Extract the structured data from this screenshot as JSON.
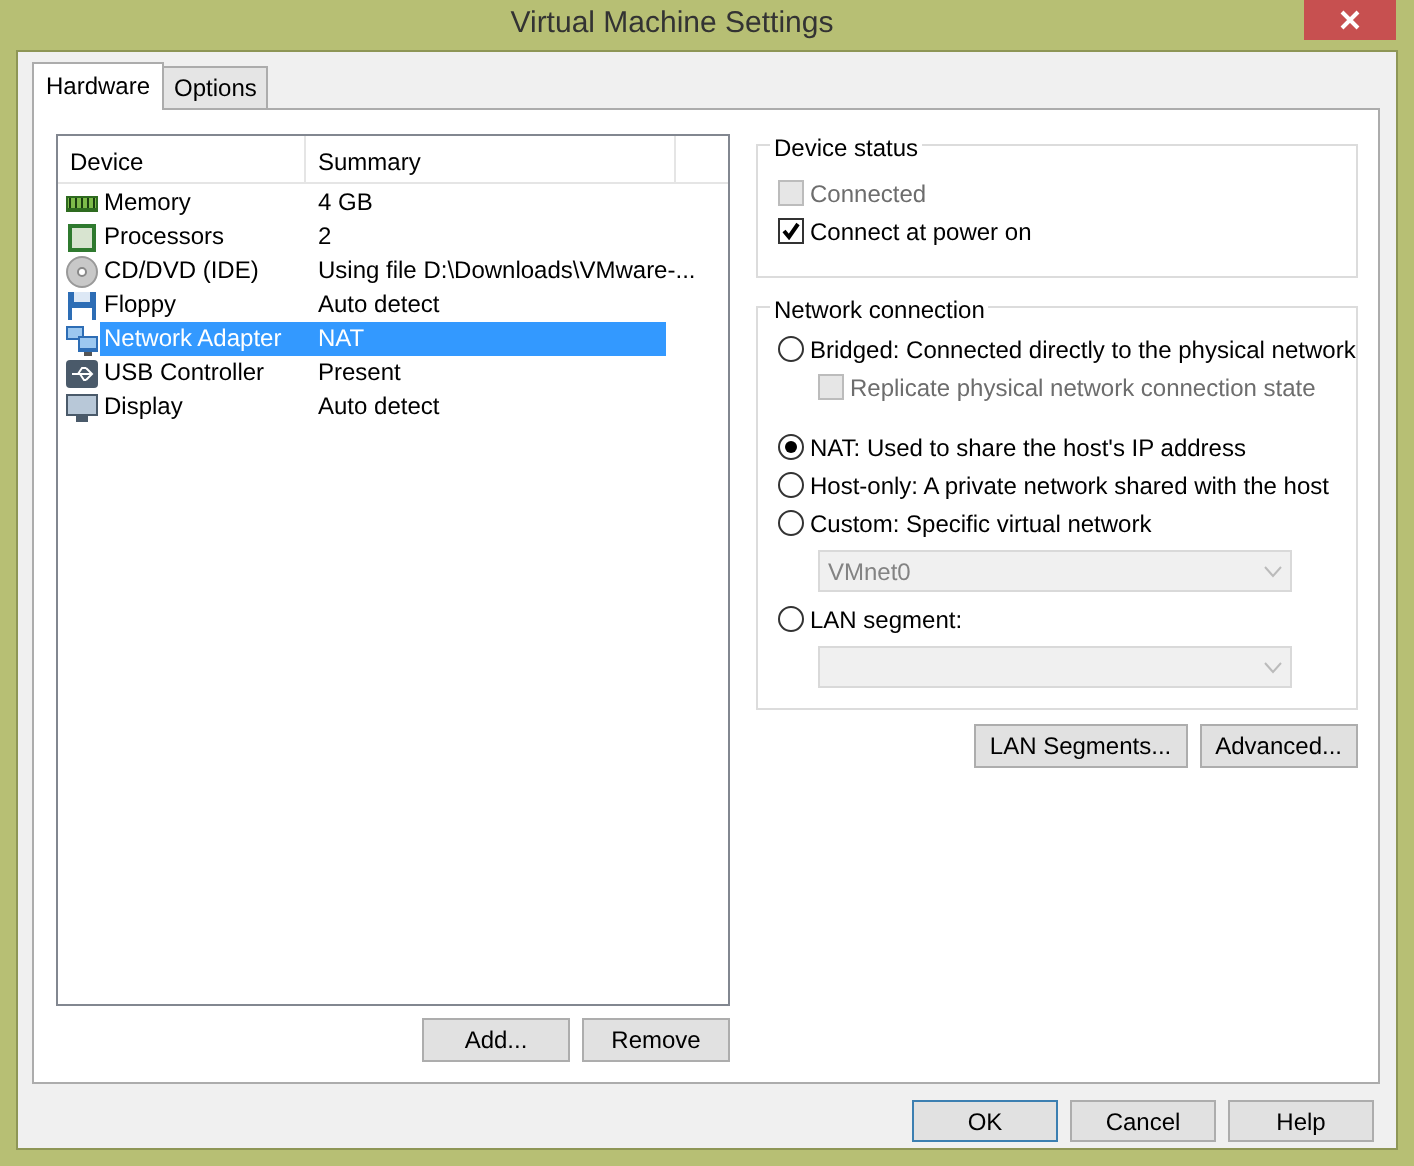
{
  "window": {
    "title": "Virtual Machine Settings"
  },
  "tabs": [
    {
      "label": "Hardware",
      "selected": true
    },
    {
      "label": "Options",
      "selected": false
    }
  ],
  "device_table": {
    "columns": [
      "Device",
      "Summary"
    ],
    "rows": [
      {
        "kind": "memory",
        "device": "Memory",
        "summary": "4 GB",
        "selected": false
      },
      {
        "kind": "processor",
        "device": "Processors",
        "summary": "2",
        "selected": false
      },
      {
        "kind": "disc",
        "device": "CD/DVD (IDE)",
        "summary": "Using file D:\\Downloads\\VMware-...",
        "selected": false
      },
      {
        "kind": "floppy",
        "device": "Floppy",
        "summary": "Auto detect",
        "selected": false
      },
      {
        "kind": "network",
        "device": "Network Adapter",
        "summary": "NAT",
        "selected": true
      },
      {
        "kind": "usb",
        "device": "USB Controller",
        "summary": "Present",
        "selected": false
      },
      {
        "kind": "display",
        "device": "Display",
        "summary": "Auto detect",
        "selected": false
      }
    ]
  },
  "list_buttons": [
    "Add...",
    "Remove"
  ],
  "device_status": {
    "title": "Device status",
    "checkboxes": [
      {
        "label": "Connected",
        "checked": false,
        "disabled": true
      },
      {
        "label": "Connect at power on",
        "checked": true,
        "disabled": false
      }
    ]
  },
  "network_connection": {
    "title": "Network connection",
    "options": [
      {
        "kind": "radio",
        "label": "Bridged: Connected directly to the physical network",
        "selected": false
      },
      {
        "kind": "checkbox",
        "label": "Replicate physical network connection state",
        "checked": false,
        "disabled": true
      },
      {
        "kind": "radio",
        "label": "NAT: Used to share the host's IP address",
        "selected": true
      },
      {
        "kind": "radio",
        "label": "Host-only: A private network shared with the host",
        "selected": false
      },
      {
        "kind": "radio",
        "label": "Custom: Specific virtual network",
        "selected": false
      },
      {
        "kind": "select",
        "value": "VMnet0",
        "disabled": true
      },
      {
        "kind": "radio",
        "label": "LAN segment:",
        "selected": false
      },
      {
        "kind": "select",
        "disabled": true
      }
    ]
  },
  "network_buttons": [
    "LAN Segments...",
    "Advanced..."
  ],
  "dialog_buttons": [
    {
      "label": "OK",
      "default": true
    },
    {
      "label": "Cancel",
      "default": false
    },
    {
      "label": "Help",
      "default": false
    }
  ]
}
